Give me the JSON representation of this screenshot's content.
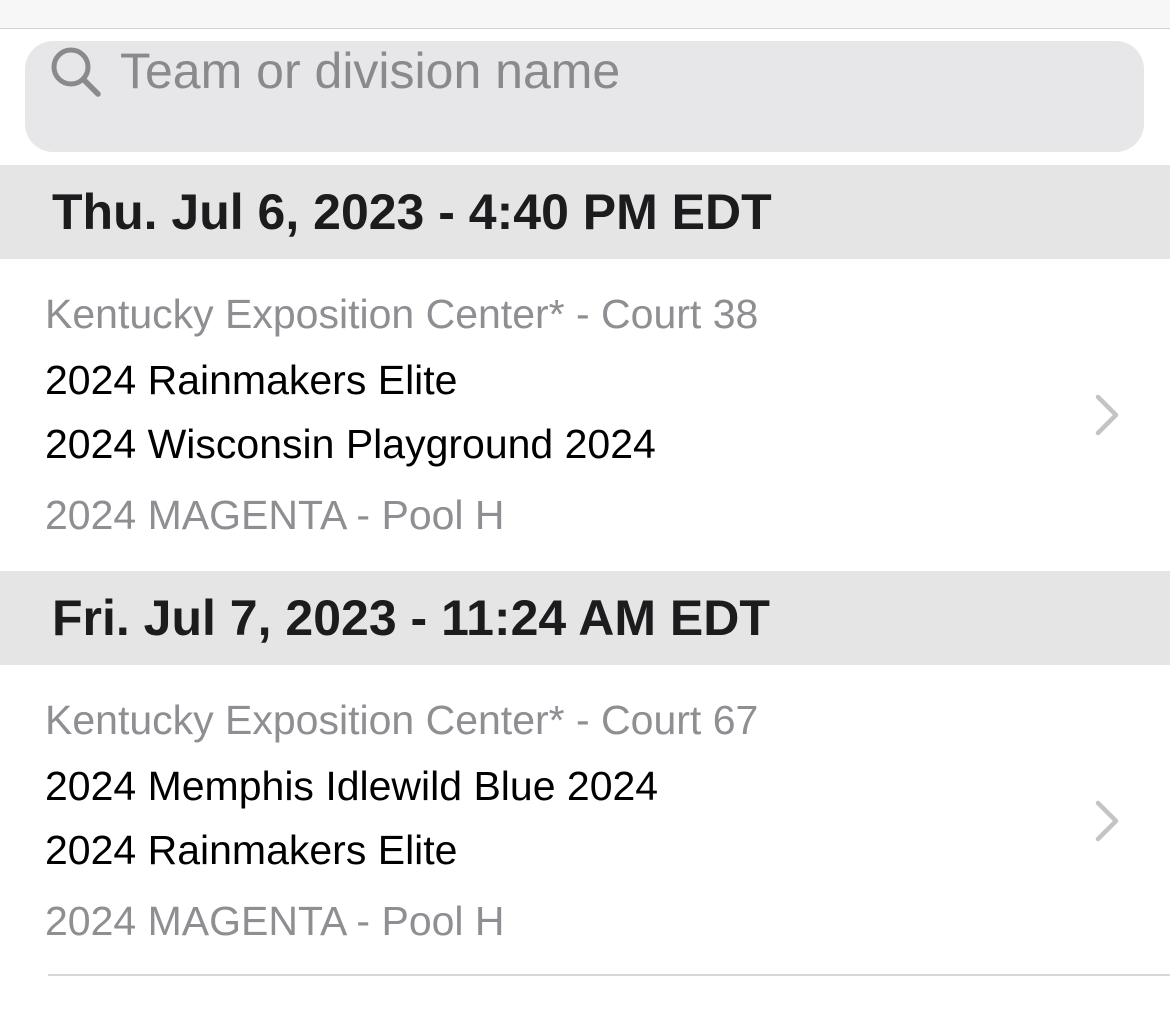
{
  "search": {
    "placeholder": "Team or division name",
    "value": ""
  },
  "sections": [
    {
      "header": "Thu. Jul 6, 2023 - 4:40 PM EDT",
      "game": {
        "location": "Kentucky Exposition Center* - Court 38",
        "team1": "2024 Rainmakers Elite",
        "team2": "2024 Wisconsin Playground 2024",
        "division": "2024 MAGENTA - Pool H"
      }
    },
    {
      "header": "Fri. Jul 7, 2023 - 11:24 AM EDT",
      "game": {
        "location": "Kentucky Exposition Center* - Court 67",
        "team1": "2024 Memphis Idlewild Blue 2024",
        "team2": "2024 Rainmakers Elite",
        "division": "2024 MAGENTA - Pool H"
      }
    }
  ],
  "icons": {
    "search": "search-icon",
    "chevron": "chevron-right-icon"
  },
  "colors": {
    "section_header_bg": "#e5e5e5",
    "search_bg": "#e7e7ea",
    "secondary_text": "#8e8e93",
    "chevron": "#c4c4c7"
  }
}
